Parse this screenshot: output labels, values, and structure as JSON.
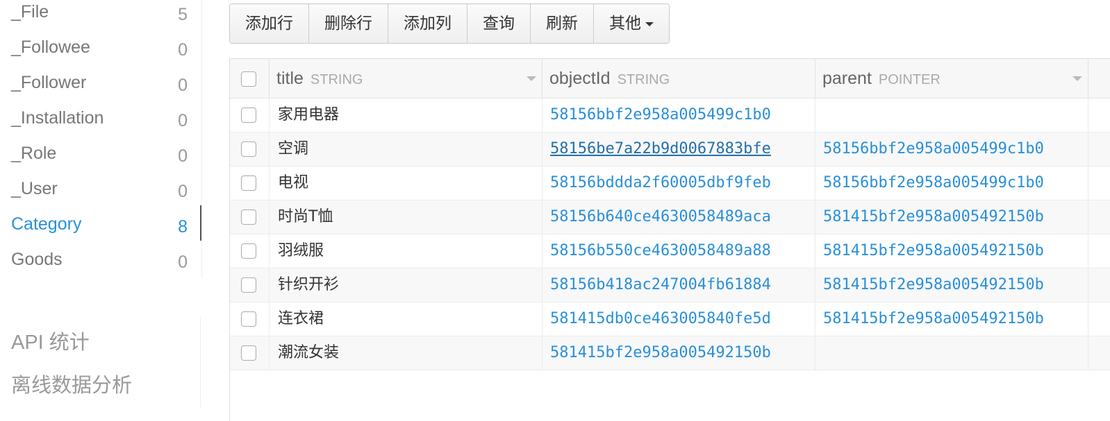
{
  "sidebar": {
    "classes": [
      {
        "name": "_File",
        "count": "5"
      },
      {
        "name": "_Followee",
        "count": "0"
      },
      {
        "name": "_Follower",
        "count": "0"
      },
      {
        "name": "_Installation",
        "count": "0"
      },
      {
        "name": "_Role",
        "count": "0"
      },
      {
        "name": "_User",
        "count": "0"
      },
      {
        "name": "Category",
        "count": "8"
      },
      {
        "name": "Goods",
        "count": "0"
      }
    ],
    "api_stats": "API 统计",
    "offline_analysis": "离线数据分析"
  },
  "toolbar": {
    "add_row": "添加行",
    "delete_row": "删除行",
    "add_column": "添加列",
    "query": "查询",
    "refresh": "刷新",
    "more": "其他"
  },
  "table": {
    "columns": [
      {
        "name": "title",
        "type": "STRING"
      },
      {
        "name": "objectId",
        "type": "STRING"
      },
      {
        "name": "parent",
        "type": "POINTER"
      }
    ],
    "rows": [
      {
        "title": "家用电器",
        "objectId": "58156bbf2e958a005499c1b0",
        "parent": ""
      },
      {
        "title": "空调",
        "objectId": "58156be7a22b9d0067883bfe",
        "parent": "58156bbf2e958a005499c1b0"
      },
      {
        "title": "电视",
        "objectId": "58156bddda2f60005dbf9feb",
        "parent": "58156bbf2e958a005499c1b0"
      },
      {
        "title": "时尚T恤",
        "objectId": "58156b640ce4630058489aca",
        "parent": "581415bf2e958a005492150b"
      },
      {
        "title": "羽绒服",
        "objectId": "58156b550ce4630058489a88",
        "parent": "581415bf2e958a005492150b"
      },
      {
        "title": "针织开衫",
        "objectId": "58156b418ac247004fb61884",
        "parent": "581415bf2e958a005492150b"
      },
      {
        "title": "连衣裙",
        "objectId": "581415db0ce463005840fe5d",
        "parent": "581415bf2e958a005492150b"
      },
      {
        "title": "潮流女装",
        "objectId": "581415bf2e958a005492150b",
        "parent": ""
      }
    ]
  },
  "colors": {
    "accent": "#2a8fd9",
    "muted_text": "#999999"
  }
}
